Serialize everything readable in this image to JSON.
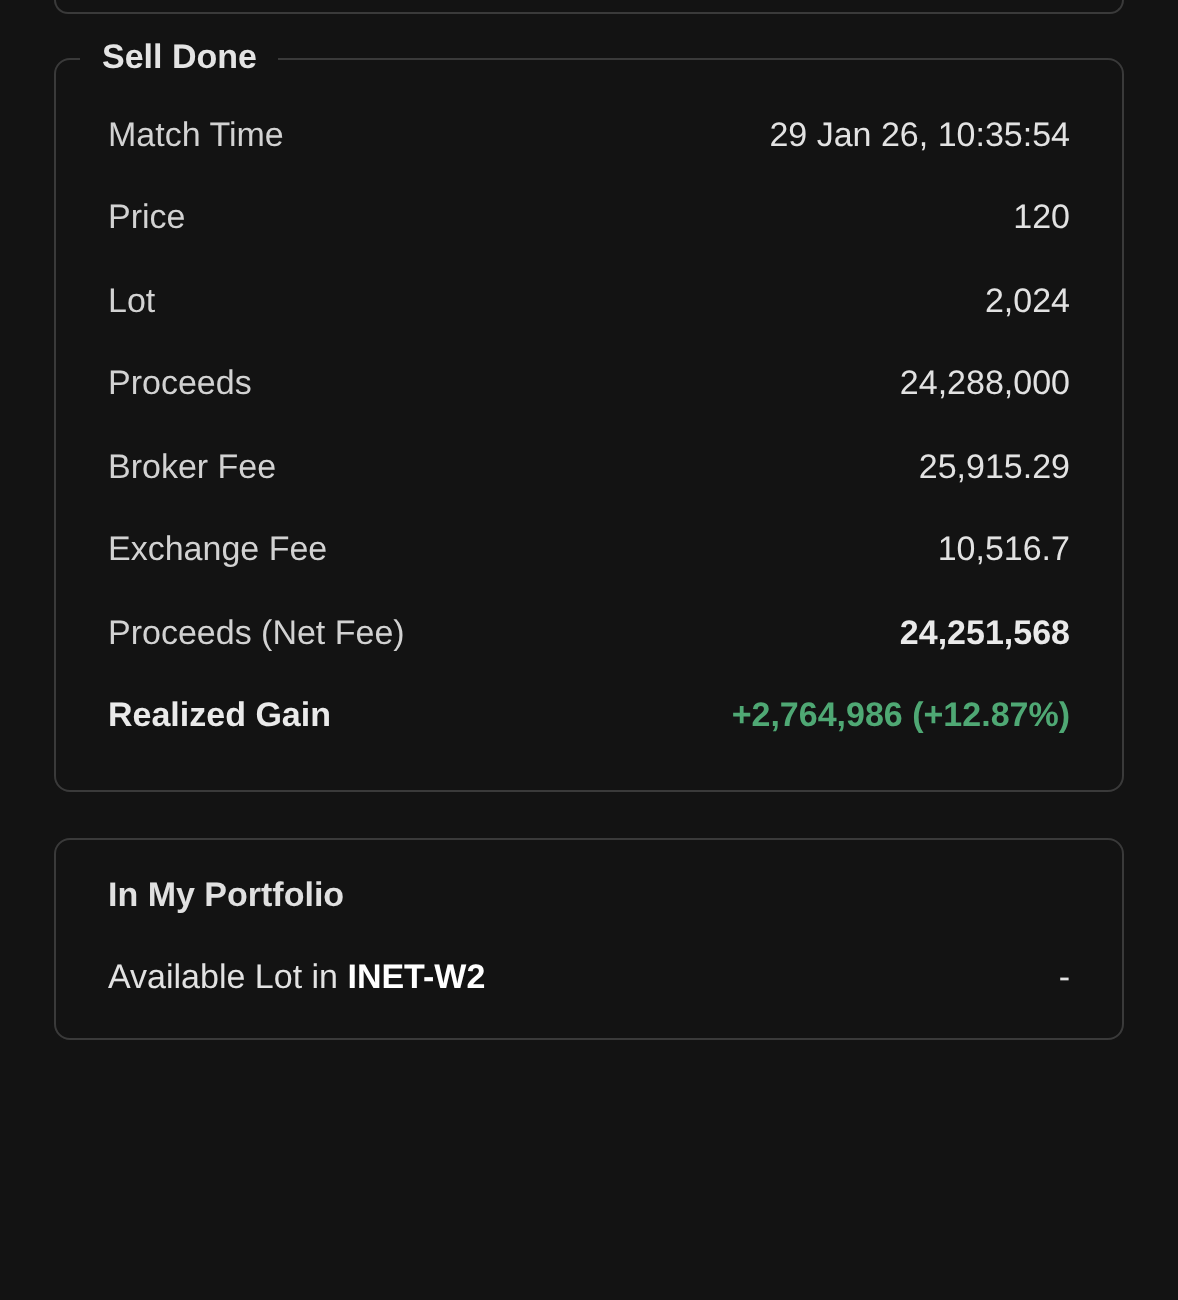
{
  "sell_done": {
    "title": "Sell Done",
    "rows": [
      {
        "kind": "plain",
        "label": "Match Time",
        "value": "29 Jan 26, 10:35:54"
      },
      {
        "kind": "plain",
        "label": "Price",
        "value": "120"
      },
      {
        "kind": "plain",
        "label": "Lot",
        "value": "2,024"
      },
      {
        "kind": "plain",
        "label": "Proceeds",
        "value": "24,288,000"
      },
      {
        "kind": "plain",
        "label": "Broker Fee",
        "value": "25,915.29"
      },
      {
        "kind": "plain",
        "label": "Exchange Fee",
        "value": "10,516.7"
      },
      {
        "kind": "total",
        "label": "Proceeds (Net Fee)",
        "value": "24,251,568"
      },
      {
        "kind": "gain",
        "label": "Realized Gain",
        "value": "+2,764,986 (+12.87%)"
      }
    ]
  },
  "portfolio": {
    "title": "In My Portfolio",
    "label": "Available Lot in **INET-W2**",
    "value": "-"
  }
}
